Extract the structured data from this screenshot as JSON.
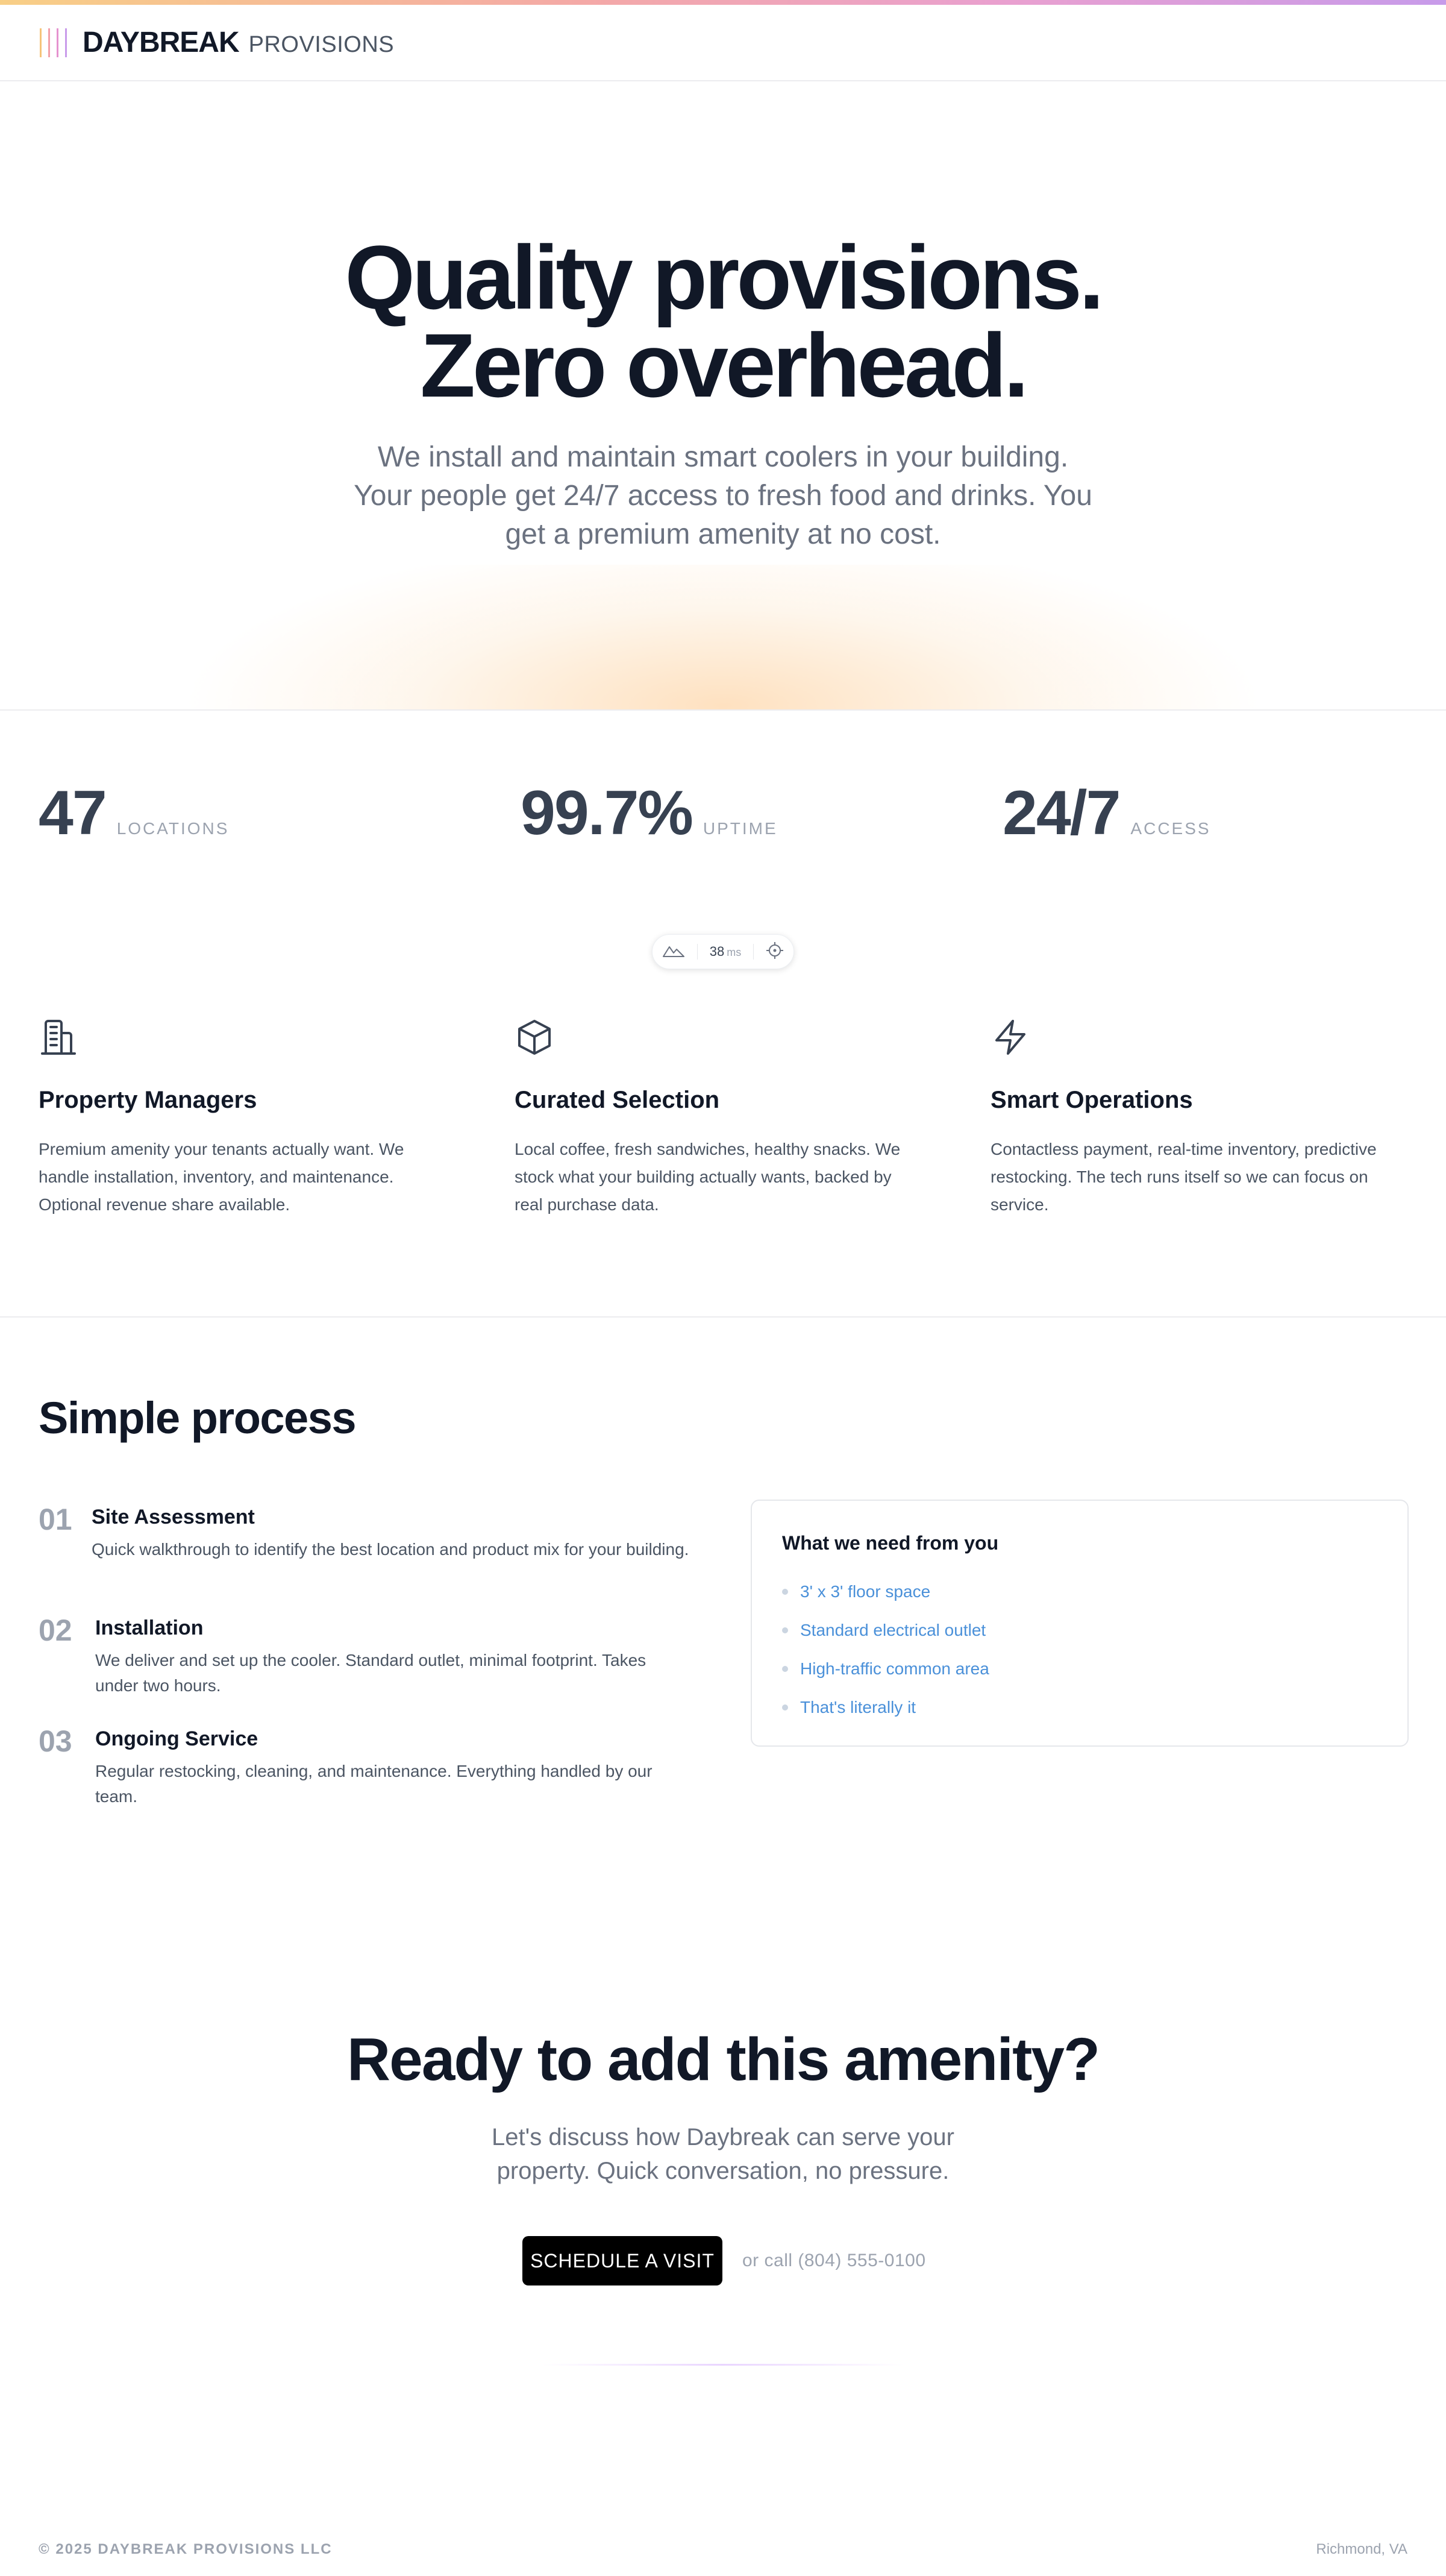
{
  "header": {
    "brand": "DAYBREAK",
    "brand_sub": "PROVISIONS",
    "logo_bar_colors": [
      "#f6c47a",
      "#f2a0a8",
      "#e592cf",
      "#c99bea"
    ]
  },
  "hero": {
    "title_line1": "Quality provisions.",
    "title_line2": "Zero overhead.",
    "subtitle": "We install and maintain smart coolers in your building. Your people get 24/7 access to fresh food and drinks. You get a premium amenity at no cost."
  },
  "stats": [
    {
      "value": "47",
      "label": "LOCATIONS"
    },
    {
      "value": "99.7%",
      "label": "UPTIME"
    },
    {
      "value": "24/7",
      "label": "ACCESS"
    }
  ],
  "widget": {
    "value": "38",
    "unit": "ms",
    "left_icon": "mountain-icon",
    "right_icon": "crosshair-icon"
  },
  "features": [
    {
      "icon": "building-icon",
      "title": "Property Managers",
      "text": "Premium amenity your tenants actually want. We handle installation, inventory, and maintenance. Optional revenue share available."
    },
    {
      "icon": "package-icon",
      "title": "Curated Selection",
      "text": "Local coffee, fresh sandwiches, healthy snacks. We stock what your building actually wants, backed by real purchase data."
    },
    {
      "icon": "lightning-icon",
      "title": "Smart Operations",
      "text": "Contactless payment, real-time inventory, predictive restocking. The tech runs itself so we can focus on service."
    }
  ],
  "process": {
    "title": "Simple process",
    "steps": [
      {
        "num": "01",
        "title": "Site Assessment",
        "text": "Quick walkthrough to identify the best location and product mix for your building."
      },
      {
        "num": "02",
        "title": "Installation",
        "text": "We deliver and set up the cooler. Standard outlet, minimal footprint. Takes under two hours."
      },
      {
        "num": "03",
        "title": "Ongoing Service",
        "text": "Regular restocking, cleaning, and maintenance. Everything handled by our team."
      }
    ],
    "card": {
      "title": "What we need from you",
      "items": [
        "3' x 3' floor space",
        "Standard electrical outlet",
        "High-traffic common area",
        "That's literally it"
      ]
    }
  },
  "cta": {
    "title": "Ready to add this amenity?",
    "subtitle": "Let's discuss how Daybreak can serve your property. Quick conversation, no pressure.",
    "button": "SCHEDULE A VISIT",
    "call": "or call (804) 555-0100"
  },
  "footer": {
    "left": "© 2025 DAYBREAK PROVISIONS LLC",
    "right": "Richmond, VA"
  }
}
